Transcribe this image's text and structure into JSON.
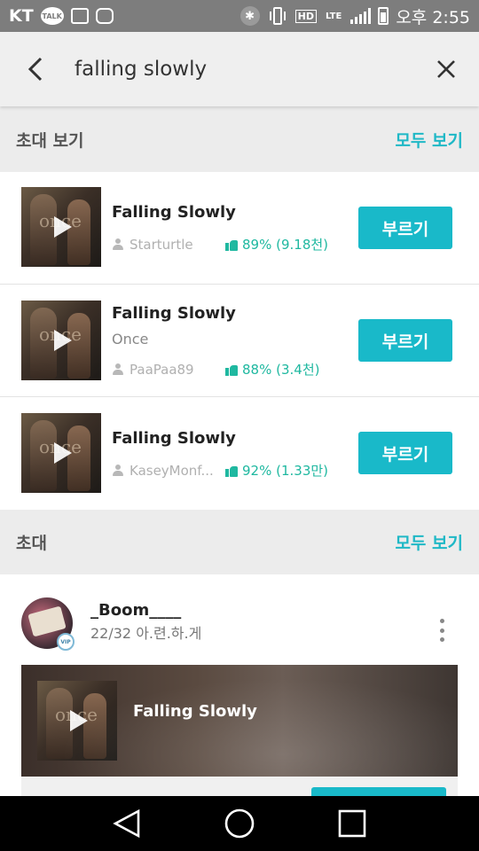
{
  "status_bar": {
    "carrier": "KT",
    "talk_badge": "TALK",
    "hd_label": "HD",
    "network_label": "LTE",
    "time": "오후 2:55",
    "icons": [
      "kakaotalk-icon",
      "gallery-icon",
      "instagram-icon",
      "bluetooth-icon",
      "vibrate-icon",
      "hd-voice-icon",
      "lte-icon",
      "signal-icon",
      "battery-icon"
    ]
  },
  "search": {
    "query": "falling slowly",
    "back_icon": "chevron-left-icon",
    "clear_icon": "close-icon"
  },
  "invite_view_section": {
    "title": "초대 보기",
    "see_all": "모두 보기"
  },
  "songs": [
    {
      "title": "Falling Slowly",
      "artist": "",
      "user": "Starturtle",
      "rating": "89% (9.18천)",
      "button": "부르기"
    },
    {
      "title": "Falling Slowly",
      "artist": "Once",
      "user": "PaaPaa89",
      "rating": "88% (3.4천)",
      "button": "부르기"
    },
    {
      "title": "Falling Slowly",
      "artist": "",
      "user": "KaseyMonf...",
      "rating": "92% (1.33만)",
      "button": "부르기"
    }
  ],
  "invite_section": {
    "title": "초대",
    "see_all": "모두 보기"
  },
  "invite_card": {
    "username": "_Boom____",
    "subtitle": "22/32 아.련.하.게",
    "vip_badge": "VIP",
    "song_title": "Falling Slowly"
  },
  "thumb_text": "once",
  "colors": {
    "accent": "#19b9c9",
    "rating_green": "#1fb8a0",
    "status_bar": "#7d7d7d",
    "header_bg": "#efefef",
    "section_bg": "#ececec"
  },
  "nav": {
    "back": "triangle-back-icon",
    "home": "circle-home-icon",
    "recents": "square-recents-icon"
  }
}
